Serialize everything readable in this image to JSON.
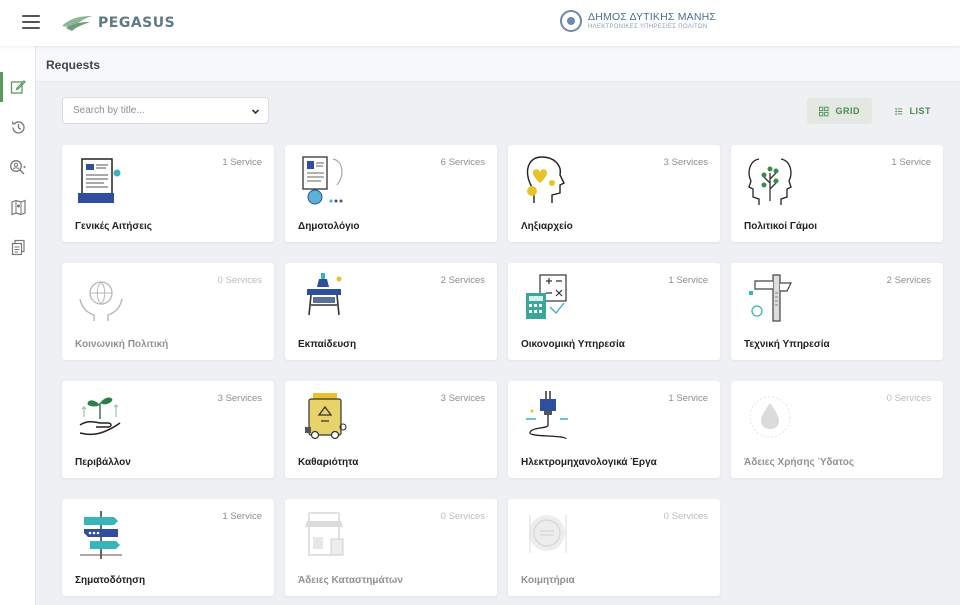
{
  "header": {
    "brand": "PEGASUS",
    "municipality_name": "ΔΗΜΟΣ ΔΥΤΙΚΗΣ ΜΑΝΗΣ",
    "municipality_sub": "ΗΛΕΚΤΡΟΝΙΚΕΣ ΥΠΗΡΕΣΙΕΣ ΠΟΛΙΤΩΝ"
  },
  "sidebar": {
    "items": [
      {
        "icon": "edit-icon",
        "active": true
      },
      {
        "icon": "history-icon",
        "active": false
      },
      {
        "icon": "search-user-icon",
        "active": false
      },
      {
        "icon": "map-icon",
        "active": false
      },
      {
        "icon": "documents-icon",
        "active": false
      }
    ]
  },
  "page": {
    "title": "Requests"
  },
  "search": {
    "placeholder": "Search by title..."
  },
  "view": {
    "grid_label": "GRID",
    "list_label": "LIST",
    "selected": "grid"
  },
  "colors": {
    "accent": "#4a8a4f",
    "illustration_blue": "#2f4f9e",
    "illustration_teal": "#38b5b8",
    "illustration_yellow": "#e8c22b"
  },
  "cards": [
    {
      "title": "Γενικές Αιτήσεις",
      "count": "1 Service",
      "disabled": false
    },
    {
      "title": "Δημοτολόγιο",
      "count": "6 Services",
      "disabled": false
    },
    {
      "title": "Ληξιαρχείο",
      "count": "3 Services",
      "disabled": false
    },
    {
      "title": "Πολιτικοί Γάμοι",
      "count": "1 Service",
      "disabled": false
    },
    {
      "title": "Κοινωνική Πολιτική",
      "count": "0 Services",
      "disabled": true
    },
    {
      "title": "Εκπαίδευση",
      "count": "2 Services",
      "disabled": false
    },
    {
      "title": "Οικονομική Υπηρεσία",
      "count": "1 Service",
      "disabled": false
    },
    {
      "title": "Τεχνική Υπηρεσία",
      "count": "2 Services",
      "disabled": false
    },
    {
      "title": "Περιβάλλον",
      "count": "3 Services",
      "disabled": false
    },
    {
      "title": "Καθαριότητα",
      "count": "3 Services",
      "disabled": false
    },
    {
      "title": "Ηλεκτρομηχανολογικά Έργα",
      "count": "1 Service",
      "disabled": false
    },
    {
      "title": "Άδειες Χρήσης Ύδατος",
      "count": "0 Services",
      "disabled": true
    },
    {
      "title": "Σηματοδότηση",
      "count": "1 Service",
      "disabled": false
    },
    {
      "title": "Άδειες Καταστημάτων",
      "count": "0 Services",
      "disabled": true
    },
    {
      "title": "Κοιμητήρια",
      "count": "0 Services",
      "disabled": true
    }
  ]
}
